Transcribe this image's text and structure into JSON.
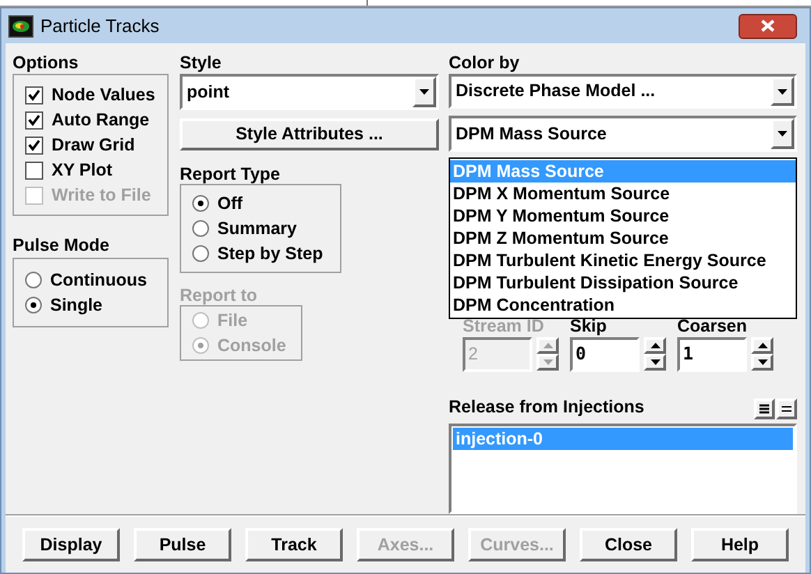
{
  "window": {
    "title": "Particle Tracks"
  },
  "options": {
    "label": "Options",
    "items": [
      {
        "label": "Node Values",
        "checked": true,
        "disabled": false
      },
      {
        "label": "Auto Range",
        "checked": true,
        "disabled": false
      },
      {
        "label": "Draw Grid",
        "checked": true,
        "disabled": false
      },
      {
        "label": "XY Plot",
        "checked": false,
        "disabled": false
      },
      {
        "label": "Write to File",
        "checked": false,
        "disabled": true
      }
    ]
  },
  "pulse_mode": {
    "label": "Pulse Mode",
    "items": [
      {
        "label": "Continuous",
        "selected": false
      },
      {
        "label": "Single",
        "selected": true
      }
    ]
  },
  "style": {
    "label": "Style",
    "value": "point",
    "attributes_button": "Style Attributes ..."
  },
  "report_type": {
    "label": "Report Type",
    "items": [
      {
        "label": "Off",
        "selected": true
      },
      {
        "label": "Summary",
        "selected": false
      },
      {
        "label": "Step by Step",
        "selected": false
      }
    ]
  },
  "report_to": {
    "label": "Report to",
    "disabled": true,
    "items": [
      {
        "label": "File",
        "selected": false
      },
      {
        "label": "Console",
        "selected": true
      }
    ]
  },
  "color_by": {
    "label": "Color by",
    "category": "Discrete Phase Model ...",
    "value": "DPM Mass Source",
    "options": [
      {
        "label": "DPM Mass Source",
        "selected": true
      },
      {
        "label": "DPM X Momentum Source",
        "selected": false
      },
      {
        "label": "DPM Y Momentum Source",
        "selected": false
      },
      {
        "label": "DPM Z Momentum Source",
        "selected": false
      },
      {
        "label": "DPM Turbulent Kinetic Energy Source",
        "selected": false
      },
      {
        "label": "DPM Turbulent Dissipation Source",
        "selected": false
      },
      {
        "label": "DPM Concentration",
        "selected": false
      }
    ]
  },
  "spinners": [
    {
      "label": "Stream ID",
      "value": "2",
      "disabled": true
    },
    {
      "label": "Skip",
      "value": "0",
      "disabled": false
    },
    {
      "label": "Coarsen",
      "value": "1",
      "disabled": false
    }
  ],
  "injections": {
    "label": "Release from Injections",
    "items": [
      {
        "label": "injection-0",
        "selected": true
      }
    ]
  },
  "buttons": [
    {
      "label": "Display",
      "disabled": false
    },
    {
      "label": "Pulse",
      "disabled": false
    },
    {
      "label": "Track",
      "disabled": false
    },
    {
      "label": "Axes...",
      "disabled": true
    },
    {
      "label": "Curves...",
      "disabled": true
    },
    {
      "label": "Close",
      "disabled": false
    },
    {
      "label": "Help",
      "disabled": false
    }
  ]
}
